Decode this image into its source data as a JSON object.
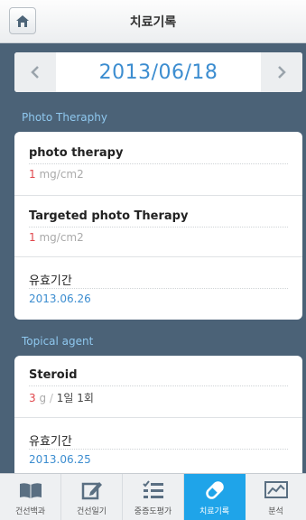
{
  "header": {
    "title": "치료기록",
    "home_icon": "home-icon"
  },
  "date_nav": {
    "date": "2013/06/18",
    "prev_icon": "chevron-left-icon",
    "next_icon": "chevron-right-icon"
  },
  "sections": {
    "photo": {
      "title": "Photo Theraphy",
      "items": [
        {
          "name": "photo therapy",
          "value": "1",
          "unit": "mg/cm2"
        },
        {
          "name": "Targeted photo Therapy",
          "value": "1",
          "unit": "mg/cm2"
        },
        {
          "name": "유효기간",
          "date": "2013.06.26"
        }
      ]
    },
    "topical": {
      "title": "Topical agent",
      "items": [
        {
          "name": "Steroid",
          "value": "3",
          "unit": "g",
          "separator": "/",
          "frequency": "1일 1회"
        },
        {
          "name": "유효기간",
          "date": "2013.06.25"
        }
      ]
    }
  },
  "tabs": [
    {
      "label": "건선백과",
      "icon": "book-icon"
    },
    {
      "label": "건선일기",
      "icon": "edit-note-icon"
    },
    {
      "label": "중증도평가",
      "icon": "checklist-icon"
    },
    {
      "label": "치료기록",
      "icon": "pill-icon",
      "active": true
    },
    {
      "label": "분석",
      "icon": "chart-icon"
    }
  ],
  "colors": {
    "accent": "#1fa4e9",
    "date_blue": "#3c8dd0",
    "value_red": "#e0474c",
    "background": "#4b6277"
  }
}
